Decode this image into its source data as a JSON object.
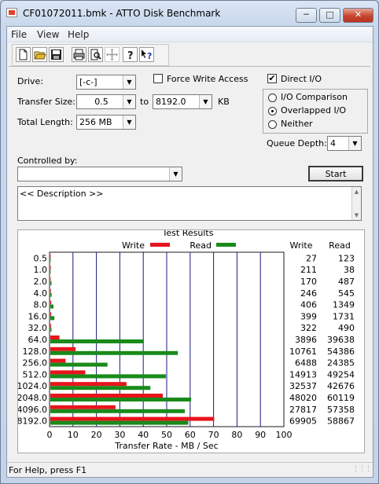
{
  "window": {
    "title": "CF01072011.bmk - ATTO Disk Benchmark"
  },
  "menu": {
    "items": [
      "File",
      "View",
      "Help"
    ]
  },
  "toolbar": {
    "icons": [
      "new-file-icon",
      "open-folder-icon",
      "save-icon",
      "print-icon",
      "print-preview-icon",
      "move-icon",
      "help-icon",
      "context-help-icon"
    ]
  },
  "settings": {
    "drive_label": "Drive:",
    "drive_value": "[-c-]",
    "force_write_access_label": "Force Write Access",
    "force_write_access_checked": false,
    "direct_io_label": "Direct I/O",
    "direct_io_checked": true,
    "transfer_size_label": "Transfer Size:",
    "transfer_from": "0.5",
    "transfer_to_label": "to",
    "transfer_to": "8192.0",
    "transfer_unit": "KB",
    "total_length_label": "Total Length:",
    "total_length_value": "256 MB",
    "io_options": [
      "I/O Comparison",
      "Overlapped I/O",
      "Neither"
    ],
    "io_selected": "Overlapped I/O",
    "queue_depth_label": "Queue Depth:",
    "queue_depth_value": "4",
    "controlled_by_label": "Controlled by:",
    "controlled_by_value": "",
    "start_label": "Start",
    "description_text": "<< Description >>"
  },
  "results": {
    "title": "Test Results",
    "legend_write": "Write",
    "legend_read": "Read",
    "col_write": "Write",
    "col_read": "Read",
    "write_color": "#e8141b",
    "read_color": "#1a8a1a",
    "grid_color": "#1a1a80"
  },
  "chart_data": {
    "type": "bar",
    "orientation": "horizontal",
    "categories": [
      "0.5",
      "1.0",
      "2.0",
      "4.0",
      "8.0",
      "16.0",
      "32.0",
      "64.0",
      "128.0",
      "256.0",
      "512.0",
      "1024.0",
      "2048.0",
      "4096.0",
      "8192.0"
    ],
    "series": [
      {
        "name": "Write",
        "values": [
          0.03,
          0.21,
          0.17,
          0.25,
          0.41,
          0.4,
          0.32,
          3.9,
          10.8,
          6.5,
          14.9,
          32.5,
          48.0,
          27.8,
          69.9
        ]
      },
      {
        "name": "Read",
        "values": [
          0.12,
          0.04,
          0.49,
          0.55,
          1.35,
          1.73,
          0.49,
          39.6,
          54.4,
          24.4,
          49.3,
          42.7,
          60.1,
          57.4,
          58.9
        ]
      }
    ],
    "write_readings": [
      "27",
      "211",
      "170",
      "246",
      "406",
      "399",
      "322",
      "3896",
      "10761",
      "6488",
      "14913",
      "32537",
      "48020",
      "27817",
      "69905"
    ],
    "read_readings": [
      "123",
      "38",
      "487",
      "545",
      "1349",
      "1731",
      "490",
      "39638",
      "54386",
      "24385",
      "49254",
      "42676",
      "60119",
      "57358",
      "58867"
    ],
    "x_ticks": [
      "0",
      "10",
      "20",
      "30",
      "40",
      "50",
      "60",
      "70",
      "80",
      "90",
      "100"
    ],
    "xlim": [
      0,
      100
    ],
    "xlabel": "Transfer Rate - MB / Sec",
    "grid": true,
    "legend": "top"
  },
  "statusbar": {
    "text": "For Help, press F1"
  }
}
